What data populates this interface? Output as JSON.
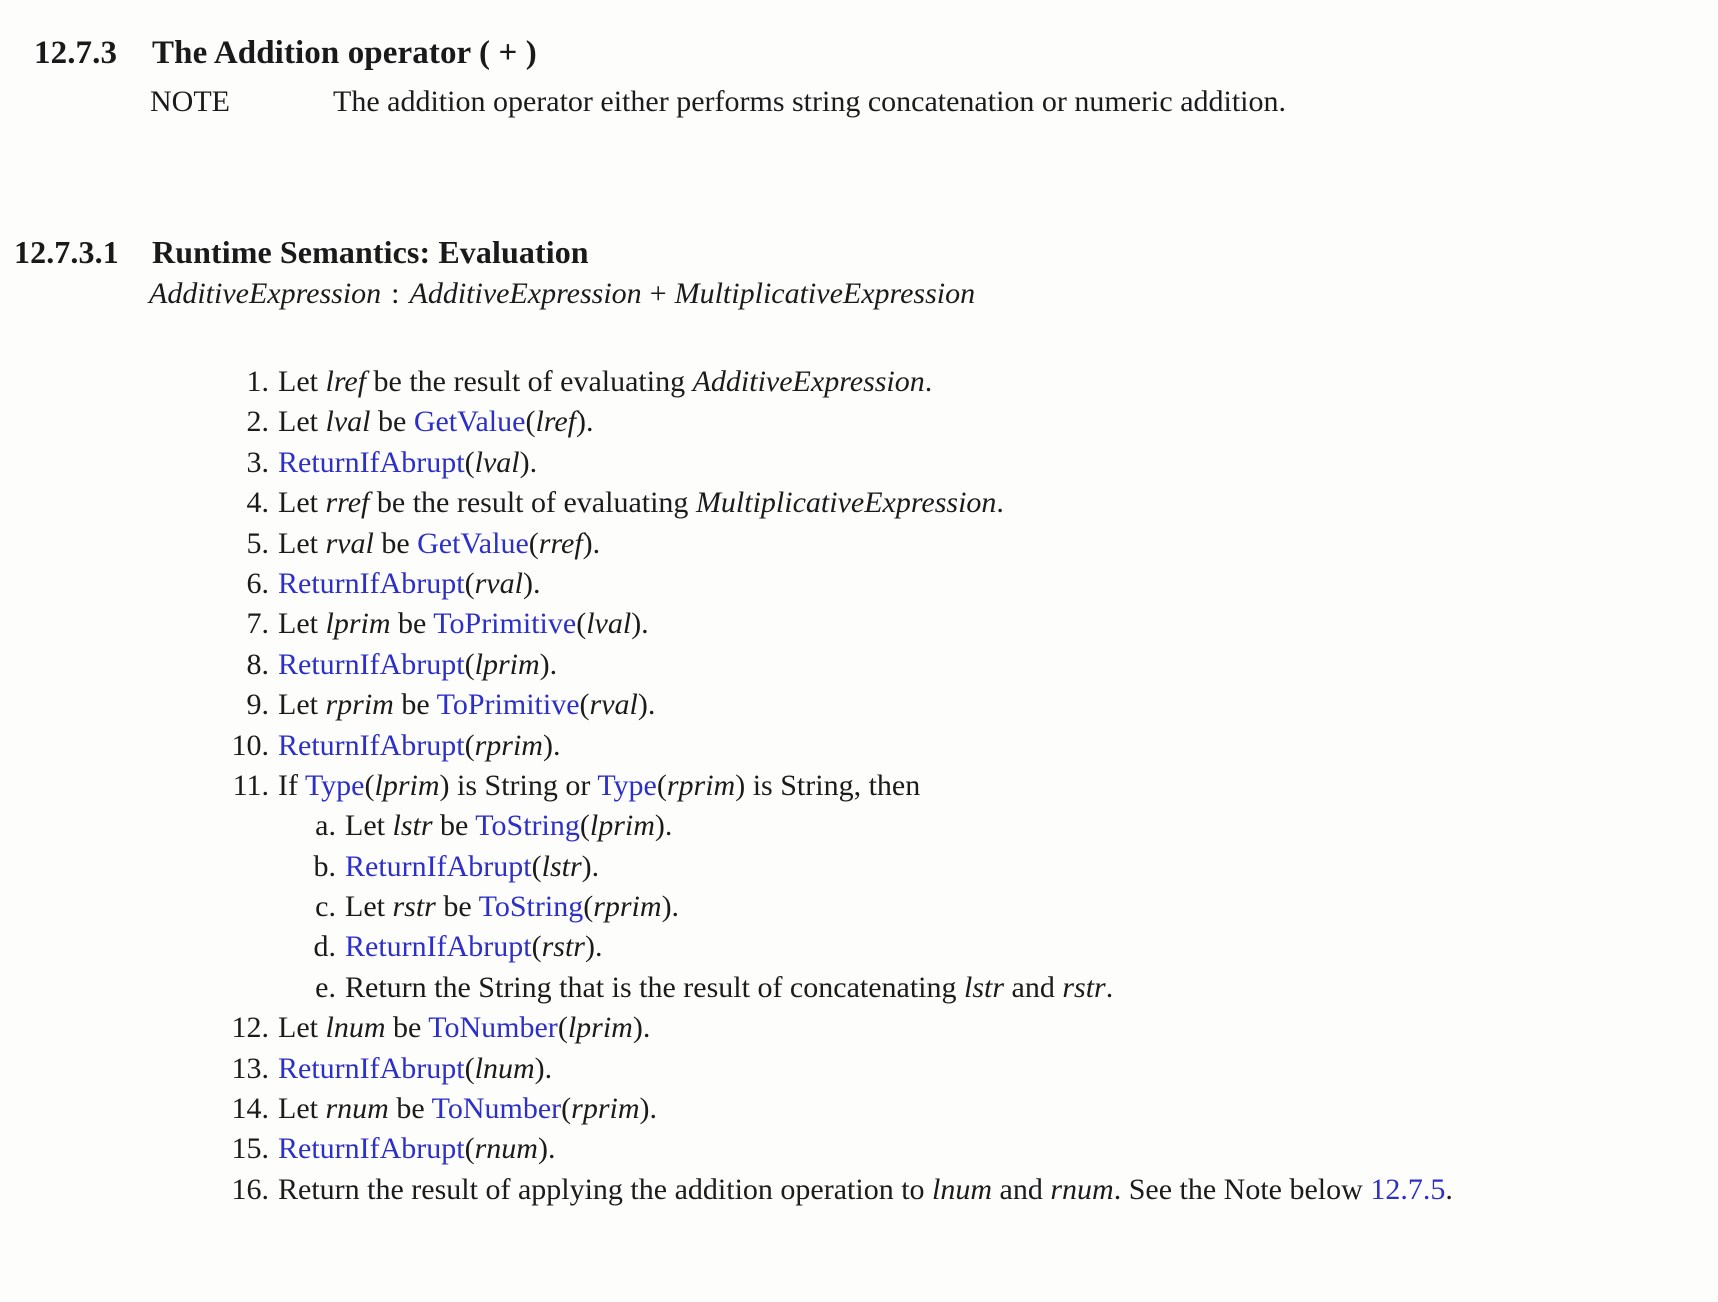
{
  "document": {
    "background_color": "#fdfdfb",
    "text_color": "#1b1b1b",
    "link_color": "#2d30c8"
  },
  "clause": {
    "number": "12.7.3",
    "title": "The Addition operator ( + )"
  },
  "note": {
    "label": "NOTE",
    "text": "The addition operator either performs string concatenation or numeric addition."
  },
  "subclause": {
    "number": "12.7.3.1",
    "title": "Runtime Semantics: Evaluation"
  },
  "production": {
    "lhs": "AdditiveExpression",
    "separator": ":",
    "rhs_first": "AdditiveExpression",
    "operator": "+",
    "rhs_second": "MultiplicativeExpression"
  },
  "steps": [
    {
      "level": 1,
      "marker": "1.",
      "parts": [
        {
          "t": "Let ",
          "k": "plain"
        },
        {
          "t": "lref",
          "k": "var"
        },
        {
          "t": " be the result of evaluating ",
          "k": "plain"
        },
        {
          "t": "AdditiveExpression",
          "k": "var"
        },
        {
          "t": ".",
          "k": "plain"
        }
      ]
    },
    {
      "level": 1,
      "marker": "2.",
      "parts": [
        {
          "t": "Let ",
          "k": "plain"
        },
        {
          "t": "lval",
          "k": "var"
        },
        {
          "t": " be ",
          "k": "plain"
        },
        {
          "t": "GetValue",
          "k": "op"
        },
        {
          "t": "(",
          "k": "plain"
        },
        {
          "t": "lref",
          "k": "var"
        },
        {
          "t": ").",
          "k": "plain"
        }
      ]
    },
    {
      "level": 1,
      "marker": "3.",
      "parts": [
        {
          "t": "ReturnIfAbrupt",
          "k": "op"
        },
        {
          "t": "(",
          "k": "plain"
        },
        {
          "t": "lval",
          "k": "var"
        },
        {
          "t": ").",
          "k": "plain"
        }
      ]
    },
    {
      "level": 1,
      "marker": "4.",
      "parts": [
        {
          "t": "Let ",
          "k": "plain"
        },
        {
          "t": "rref",
          "k": "var"
        },
        {
          "t": " be the result of evaluating ",
          "k": "plain"
        },
        {
          "t": "MultiplicativeExpression",
          "k": "var"
        },
        {
          "t": ".",
          "k": "plain"
        }
      ]
    },
    {
      "level": 1,
      "marker": "5.",
      "parts": [
        {
          "t": "Let ",
          "k": "plain"
        },
        {
          "t": "rval",
          "k": "var"
        },
        {
          "t": " be ",
          "k": "plain"
        },
        {
          "t": "GetValue",
          "k": "op"
        },
        {
          "t": "(",
          "k": "plain"
        },
        {
          "t": "rref",
          "k": "var"
        },
        {
          "t": ").",
          "k": "plain"
        }
      ]
    },
    {
      "level": 1,
      "marker": "6.",
      "parts": [
        {
          "t": "ReturnIfAbrupt",
          "k": "op"
        },
        {
          "t": "(",
          "k": "plain"
        },
        {
          "t": "rval",
          "k": "var"
        },
        {
          "t": ").",
          "k": "plain"
        }
      ]
    },
    {
      "level": 1,
      "marker": "7.",
      "parts": [
        {
          "t": "Let ",
          "k": "plain"
        },
        {
          "t": "lprim",
          "k": "var"
        },
        {
          "t": " be ",
          "k": "plain"
        },
        {
          "t": "ToPrimitive",
          "k": "op"
        },
        {
          "t": "(",
          "k": "plain"
        },
        {
          "t": "lval",
          "k": "var"
        },
        {
          "t": ").",
          "k": "plain"
        }
      ]
    },
    {
      "level": 1,
      "marker": "8.",
      "parts": [
        {
          "t": "ReturnIfAbrupt",
          "k": "op"
        },
        {
          "t": "(",
          "k": "plain"
        },
        {
          "t": "lprim",
          "k": "var"
        },
        {
          "t": ").",
          "k": "plain"
        }
      ]
    },
    {
      "level": 1,
      "marker": "9.",
      "parts": [
        {
          "t": "Let ",
          "k": "plain"
        },
        {
          "t": "rprim",
          "k": "var"
        },
        {
          "t": " be ",
          "k": "plain"
        },
        {
          "t": "ToPrimitive",
          "k": "op"
        },
        {
          "t": "(",
          "k": "plain"
        },
        {
          "t": "rval",
          "k": "var"
        },
        {
          "t": ").",
          "k": "plain"
        }
      ]
    },
    {
      "level": 1,
      "marker": "10.",
      "parts": [
        {
          "t": "ReturnIfAbrupt",
          "k": "op"
        },
        {
          "t": "(",
          "k": "plain"
        },
        {
          "t": "rprim",
          "k": "var"
        },
        {
          "t": ").",
          "k": "plain"
        }
      ]
    },
    {
      "level": 1,
      "marker": "11.",
      "parts": [
        {
          "t": "If ",
          "k": "plain"
        },
        {
          "t": "Type",
          "k": "op"
        },
        {
          "t": "(",
          "k": "plain"
        },
        {
          "t": "lprim",
          "k": "var"
        },
        {
          "t": ") is String or ",
          "k": "plain"
        },
        {
          "t": "Type",
          "k": "op"
        },
        {
          "t": "(",
          "k": "plain"
        },
        {
          "t": "rprim",
          "k": "var"
        },
        {
          "t": ") is String, then",
          "k": "plain"
        }
      ]
    },
    {
      "level": 2,
      "marker": "a.",
      "parts": [
        {
          "t": "Let ",
          "k": "plain"
        },
        {
          "t": "lstr",
          "k": "var"
        },
        {
          "t": " be ",
          "k": "plain"
        },
        {
          "t": "ToString",
          "k": "op"
        },
        {
          "t": "(",
          "k": "plain"
        },
        {
          "t": "lprim",
          "k": "var"
        },
        {
          "t": ").",
          "k": "plain"
        }
      ]
    },
    {
      "level": 2,
      "marker": "b.",
      "parts": [
        {
          "t": "ReturnIfAbrupt",
          "k": "op"
        },
        {
          "t": "(",
          "k": "plain"
        },
        {
          "t": "lstr",
          "k": "var"
        },
        {
          "t": ").",
          "k": "plain"
        }
      ]
    },
    {
      "level": 2,
      "marker": "c.",
      "parts": [
        {
          "t": "Let ",
          "k": "plain"
        },
        {
          "t": "rstr",
          "k": "var"
        },
        {
          "t": " be ",
          "k": "plain"
        },
        {
          "t": "ToString",
          "k": "op"
        },
        {
          "t": "(",
          "k": "plain"
        },
        {
          "t": "rprim",
          "k": "var"
        },
        {
          "t": ").",
          "k": "plain"
        }
      ]
    },
    {
      "level": 2,
      "marker": "d.",
      "parts": [
        {
          "t": "ReturnIfAbrupt",
          "k": "op"
        },
        {
          "t": "(",
          "k": "plain"
        },
        {
          "t": "rstr",
          "k": "var"
        },
        {
          "t": ").",
          "k": "plain"
        }
      ]
    },
    {
      "level": 2,
      "marker": "e.",
      "parts": [
        {
          "t": "Return the String that is the result of concatenating ",
          "k": "plain"
        },
        {
          "t": "lstr",
          "k": "var"
        },
        {
          "t": " and ",
          "k": "plain"
        },
        {
          "t": "rstr",
          "k": "var"
        },
        {
          "t": ".",
          "k": "plain"
        }
      ]
    },
    {
      "level": 1,
      "marker": "12.",
      "parts": [
        {
          "t": "Let ",
          "k": "plain"
        },
        {
          "t": "lnum",
          "k": "var"
        },
        {
          "t": " be ",
          "k": "plain"
        },
        {
          "t": "ToNumber",
          "k": "op"
        },
        {
          "t": "(",
          "k": "plain"
        },
        {
          "t": "lprim",
          "k": "var"
        },
        {
          "t": ").",
          "k": "plain"
        }
      ]
    },
    {
      "level": 1,
      "marker": "13.",
      "parts": [
        {
          "t": "ReturnIfAbrupt",
          "k": "op"
        },
        {
          "t": "(",
          "k": "plain"
        },
        {
          "t": "lnum",
          "k": "var"
        },
        {
          "t": ").",
          "k": "plain"
        }
      ]
    },
    {
      "level": 1,
      "marker": "14.",
      "parts": [
        {
          "t": "Let ",
          "k": "plain"
        },
        {
          "t": "rnum",
          "k": "var"
        },
        {
          "t": " be ",
          "k": "plain"
        },
        {
          "t": "ToNumber",
          "k": "op"
        },
        {
          "t": "(",
          "k": "plain"
        },
        {
          "t": "rprim",
          "k": "var"
        },
        {
          "t": ").",
          "k": "plain"
        }
      ]
    },
    {
      "level": 1,
      "marker": "15.",
      "parts": [
        {
          "t": "ReturnIfAbrupt",
          "k": "op"
        },
        {
          "t": "(",
          "k": "plain"
        },
        {
          "t": "rnum",
          "k": "var"
        },
        {
          "t": ").",
          "k": "plain"
        }
      ]
    },
    {
      "level": 1,
      "marker": "16.",
      "parts": [
        {
          "t": "Return the result of applying the addition operation to ",
          "k": "plain"
        },
        {
          "t": "lnum",
          "k": "var"
        },
        {
          "t": " and ",
          "k": "plain"
        },
        {
          "t": "rnum",
          "k": "var"
        },
        {
          "t": ". See the Note below ",
          "k": "plain"
        },
        {
          "t": "12.7.5",
          "k": "xref"
        },
        {
          "t": ".",
          "k": "plain"
        }
      ]
    }
  ]
}
